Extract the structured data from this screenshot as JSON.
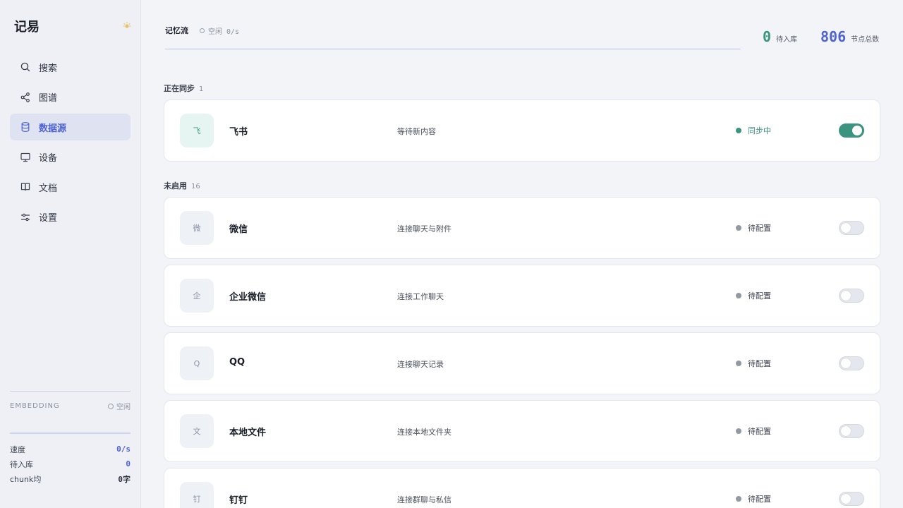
{
  "app": {
    "brand": "记易"
  },
  "nav": {
    "items": [
      {
        "label": "搜索",
        "icon": "search-icon"
      },
      {
        "label": "图谱",
        "icon": "share-graph-icon"
      },
      {
        "label": "数据源",
        "icon": "database-icon",
        "active": true
      },
      {
        "label": "设备",
        "icon": "monitor-icon"
      },
      {
        "label": "文档",
        "icon": "book-icon"
      },
      {
        "label": "设置",
        "icon": "sliders-icon"
      }
    ]
  },
  "embedding": {
    "label": "EMBEDDING",
    "status": "空闲",
    "stats": [
      {
        "label": "速度",
        "value": "0/s"
      },
      {
        "label": "待入库",
        "value": "0"
      },
      {
        "label": "chunk均",
        "value": "0字"
      }
    ]
  },
  "header": {
    "flow_title": "记忆流",
    "flow_status": "空闲 0/s",
    "pending_count": "0",
    "pending_label": "待入库",
    "nodes_count": "806",
    "nodes_label": "节点总数"
  },
  "sections": {
    "syncing": {
      "label": "正在同步",
      "count": "1"
    },
    "disabled": {
      "label": "未启用",
      "count": "16"
    }
  },
  "sources": [
    {
      "glyph": "飞",
      "name": "飞书",
      "desc": "等待新内容",
      "status": "同步中",
      "enabled": true
    },
    {
      "glyph": "微",
      "name": "微信",
      "desc": "连接聊天与附件",
      "status": "待配置",
      "enabled": false
    },
    {
      "glyph": "企",
      "name": "企业微信",
      "desc": "连接工作聊天",
      "status": "待配置",
      "enabled": false
    },
    {
      "glyph": "Q",
      "name": "QQ",
      "desc": "连接聊天记录",
      "status": "待配置",
      "enabled": false
    },
    {
      "glyph": "文",
      "name": "本地文件",
      "desc": "连接本地文件夹",
      "status": "待配置",
      "enabled": false
    },
    {
      "glyph": "钉",
      "name": "钉钉",
      "desc": "连接群聊与私信",
      "status": "待配置",
      "enabled": false
    }
  ],
  "colors": {
    "accent": "#4e63d4",
    "active_green": "#3b9480",
    "idle_gray": "#9298a4"
  }
}
